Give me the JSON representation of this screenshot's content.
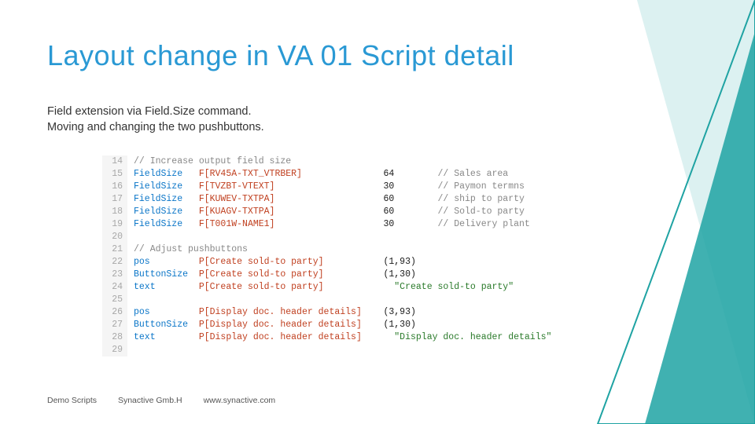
{
  "title": "Layout change in VA 01   Script detail",
  "subtitle_line1": "Field extension via Field.Size command.",
  "subtitle_line2": "Moving and changing the two pushbuttons.",
  "code": [
    {
      "n": "14",
      "cmd": "",
      "ref": "",
      "arg": "",
      "rest": "// Increase output field size"
    },
    {
      "n": "15",
      "cmd": "FieldSize",
      "ref": "F[RV45A-TXT_VTRBER]",
      "arg": "64",
      "rest": "// Sales area"
    },
    {
      "n": "16",
      "cmd": "FieldSize",
      "ref": "F[TVZBT-VTEXT]",
      "arg": "30",
      "rest": "// Paymon termns"
    },
    {
      "n": "17",
      "cmd": "FieldSize",
      "ref": "F[KUWEV-TXTPA]",
      "arg": "60",
      "rest": "// ship to party"
    },
    {
      "n": "18",
      "cmd": "FieldSize",
      "ref": "F[KUAGV-TXTPA]",
      "arg": "60",
      "rest": "// Sold-to party"
    },
    {
      "n": "19",
      "cmd": "FieldSize",
      "ref": "F[T001W-NAME1]",
      "arg": "30",
      "rest": "// Delivery plant"
    },
    {
      "n": "20",
      "cmd": "",
      "ref": "",
      "arg": "",
      "rest": ""
    },
    {
      "n": "21",
      "cmd": "",
      "ref": "",
      "arg": "",
      "rest": "// Adjust pushbuttons"
    },
    {
      "n": "22",
      "cmd": "pos",
      "ref": "P[Create sold-to party]",
      "arg": "(1,93)",
      "rest": ""
    },
    {
      "n": "23",
      "cmd": "ButtonSize",
      "ref": "P[Create sold-to party]",
      "arg": "(1,30)",
      "rest": ""
    },
    {
      "n": "24",
      "cmd": "text",
      "ref": "P[Create sold-to party]",
      "arg": "",
      "rest": "\"Create sold-to party\""
    },
    {
      "n": "25",
      "cmd": "",
      "ref": "",
      "arg": "",
      "rest": ""
    },
    {
      "n": "26",
      "cmd": "pos",
      "ref": "P[Display doc. header details]",
      "arg": "(3,93)",
      "rest": ""
    },
    {
      "n": "27",
      "cmd": "ButtonSize",
      "ref": "P[Display doc. header details]",
      "arg": "(1,30)",
      "rest": ""
    },
    {
      "n": "28",
      "cmd": "text",
      "ref": "P[Display doc. header details]",
      "arg": "",
      "rest": "\"Display doc. header details\""
    },
    {
      "n": "29",
      "cmd": "",
      "ref": "",
      "arg": "",
      "rest": ""
    }
  ],
  "footer": {
    "left": "Demo Scripts",
    "mid": "Synactive Gmb.H",
    "right": "www.synactive.com"
  },
  "colors": {
    "accent": "#2a99d4",
    "decor": "#1fa3a3"
  }
}
